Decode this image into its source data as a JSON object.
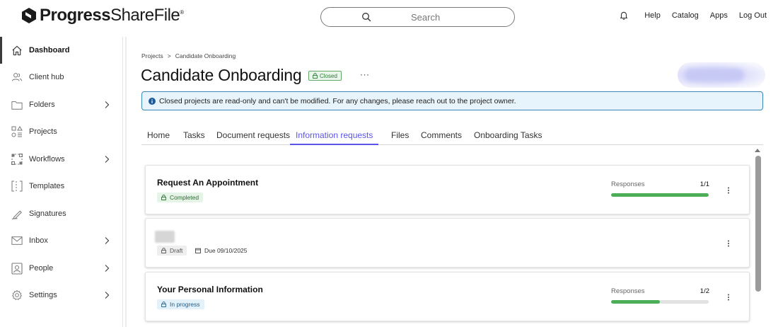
{
  "header": {
    "brand_bold": "Progress",
    "brand_light": "ShareFile",
    "brand_mark": "®",
    "search_placeholder": "Search",
    "links": [
      "Help",
      "Catalog",
      "Apps",
      "Log Out"
    ],
    "icons": [
      "bell-icon",
      "search-icon"
    ]
  },
  "sidebar": {
    "items": [
      {
        "label": "Dashboard",
        "icon": "home-icon",
        "active": true,
        "chevron": false
      },
      {
        "label": "Client hub",
        "icon": "users-icon",
        "active": false,
        "chevron": false
      },
      {
        "label": "Folders",
        "icon": "folder-icon",
        "active": false,
        "chevron": true
      },
      {
        "label": "Projects",
        "icon": "projects-icon",
        "active": false,
        "chevron": false
      },
      {
        "label": "Workflows",
        "icon": "workflow-icon",
        "active": false,
        "chevron": true
      },
      {
        "label": "Templates",
        "icon": "template-icon",
        "active": false,
        "chevron": false
      },
      {
        "label": "Signatures",
        "icon": "pen-icon",
        "active": false,
        "chevron": false
      },
      {
        "label": "Inbox",
        "icon": "mail-icon",
        "active": false,
        "chevron": true
      },
      {
        "label": "People",
        "icon": "person-card-icon",
        "active": false,
        "chevron": true
      },
      {
        "label": "Settings",
        "icon": "gear-icon",
        "active": false,
        "chevron": true
      }
    ]
  },
  "breadcrumb": {
    "parent": "Projects",
    "sep": ">",
    "current": "Candidate Onboarding"
  },
  "project": {
    "title": "Candidate Onboarding",
    "status": "Closed",
    "more": "···"
  },
  "alert": {
    "text": "Closed projects are read-only and can't be modified. For any changes, please reach out to the project owner."
  },
  "tabs": [
    {
      "label": "Home",
      "active": false
    },
    {
      "label": "Tasks",
      "active": false
    },
    {
      "label": "Document requests",
      "active": false
    },
    {
      "label": "Information requests",
      "active": true
    },
    {
      "label": "Files",
      "active": false
    },
    {
      "label": "Comments",
      "active": false
    },
    {
      "label": "Onboarding Tasks",
      "active": false
    }
  ],
  "requests": [
    {
      "title": "Request An Appointment",
      "status": "Completed",
      "responses_label": "Responses",
      "responses": "1/1",
      "progress": 1.0
    },
    {
      "title": "",
      "status": "Draft",
      "due": "Due 09/10/2025"
    },
    {
      "title": "Your Personal Information",
      "status": "In progress",
      "responses_label": "Responses",
      "responses": "1/2",
      "progress": 0.5
    }
  ],
  "colors": {
    "accent": "#5b54e8",
    "success": "#4caf57",
    "info_border": "#3a88b8",
    "info_bg": "#e8f4fb"
  }
}
